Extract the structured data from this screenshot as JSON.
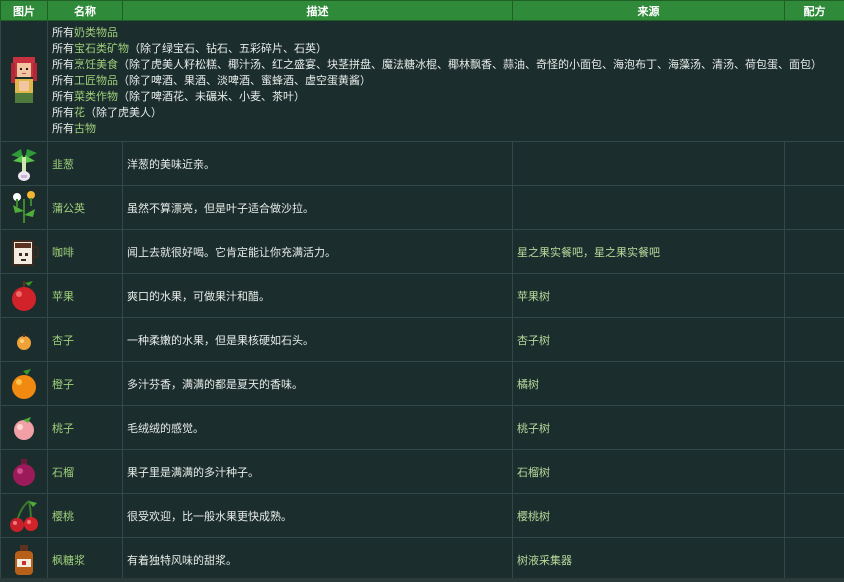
{
  "headers": {
    "image": "图片",
    "name": "名称",
    "description": "描述",
    "source": "来源",
    "recipe": "配方"
  },
  "gift_lines": [
    {
      "prefix": "所有",
      "link": "奶类物品",
      "rest": ""
    },
    {
      "prefix": "所有",
      "link": "宝石类矿物",
      "rest": "（除了绿宝石、钻石、五彩碎片、石英）"
    },
    {
      "prefix": "所有",
      "link": "烹饪美食",
      "rest": "（除了虎美人籽松糕、椰汁汤、红之盛宴、块茎拼盘、魔法糖冰棍、椰林飘香、蒜油、奇怪的小面包、海泡布丁、海藻汤、清汤、荷包蛋、面包）"
    },
    {
      "prefix": "所有",
      "link": "工匠物品",
      "rest": "（除了啤酒、果酒、淡啤酒、蜜蜂酒、虚空蛋黄酱）"
    },
    {
      "prefix": "所有",
      "link": "菜类作物",
      "rest": "（除了啤酒花、未碾米、小麦、茶叶）"
    },
    {
      "prefix": "所有",
      "link": "花",
      "rest": "（除了虎美人）"
    },
    {
      "prefix": "所有",
      "link": "古物",
      "rest": ""
    }
  ],
  "items": [
    {
      "icon": "leek-icon",
      "name": "韭葱",
      "description": "洋葱的美味近亲。",
      "source": ""
    },
    {
      "icon": "dandelion-icon",
      "name": "蒲公英",
      "description": "虽然不算漂亮，但是叶子适合做沙拉。",
      "source": ""
    },
    {
      "icon": "coffee-icon",
      "name": "咖啡",
      "description": "闻上去就很好喝。它肯定能让你充满活力。",
      "source": "星之果实餐吧，星之果实餐吧"
    },
    {
      "icon": "apple-icon",
      "name": "苹果",
      "description": "爽口的水果，可做果汁和醋。",
      "source": "苹果树"
    },
    {
      "icon": "apricot-icon",
      "name": "杏子",
      "description": "一种柔嫩的水果，但是果核硬如石头。",
      "source": "杏子树"
    },
    {
      "icon": "orange-icon",
      "name": "橙子",
      "description": "多汁芬香，满满的都是夏天的香味。",
      "source": "橘树"
    },
    {
      "icon": "peach-icon",
      "name": "桃子",
      "description": "毛绒绒的感觉。",
      "source": "桃子树"
    },
    {
      "icon": "pomegranate-icon",
      "name": "石榴",
      "description": "果子里是满满的多汁种子。",
      "source": "石榴树"
    },
    {
      "icon": "cherry-icon",
      "name": "樱桃",
      "description": "很受欢迎，比一般水果更快成熟。",
      "source": "樱桃树"
    },
    {
      "icon": "maple-syrup-icon",
      "name": "枫糖浆",
      "description": "有着独特风味的甜浆。",
      "source": "树液采集器"
    }
  ],
  "colors": {
    "header_bg": "#2f8a3a",
    "body_bg": "#1c2d2e",
    "link_green": "#9ed07a"
  }
}
